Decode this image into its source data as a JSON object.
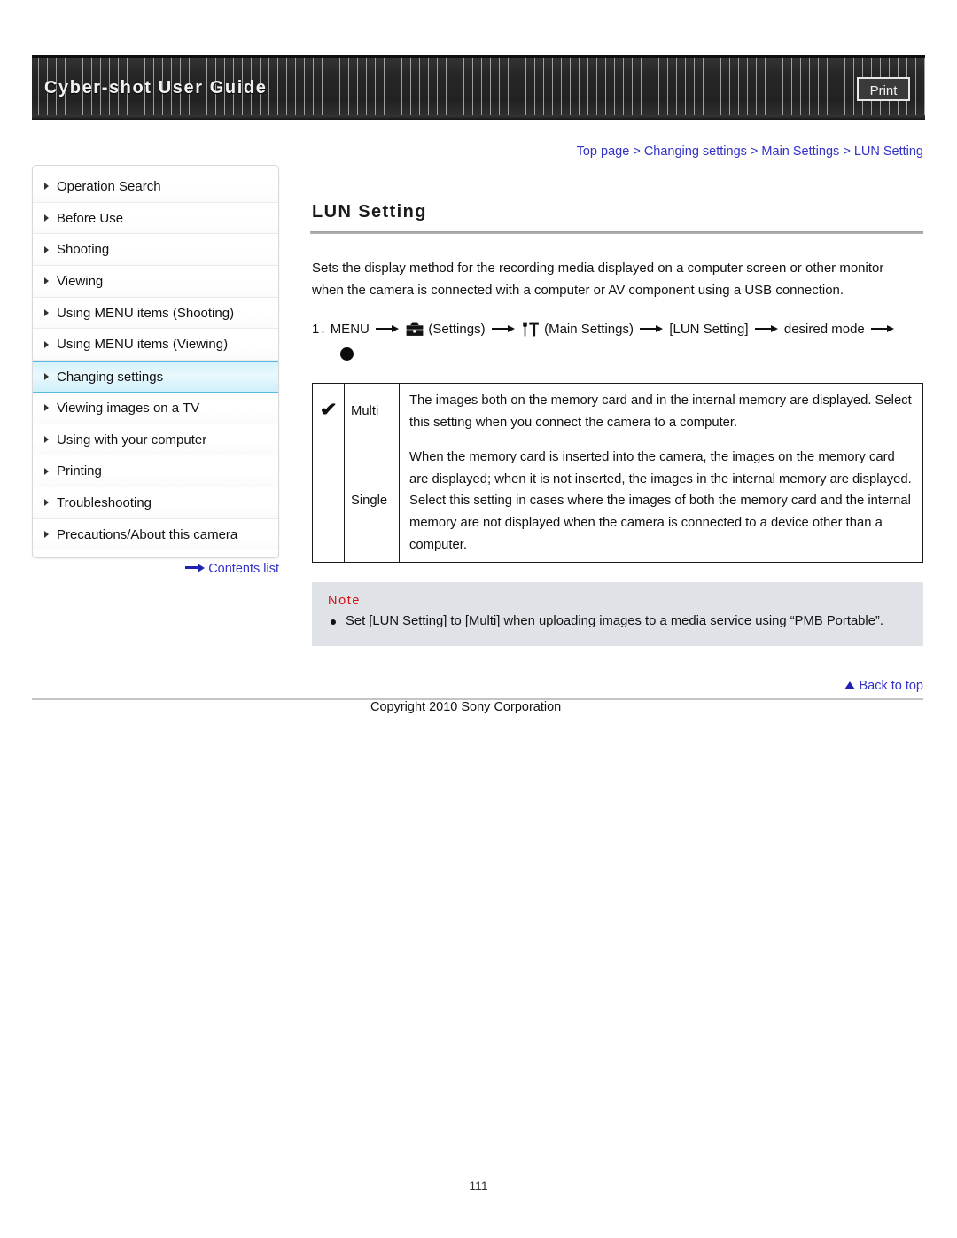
{
  "header": {
    "guide_title": "Cyber-shot User Guide",
    "print_label": "Print"
  },
  "breadcrumb": {
    "items": [
      "Top page",
      "Changing settings",
      "Main Settings",
      "LUN Setting"
    ],
    "separator": ">",
    "full_text": "Top page > Changing settings > Main Settings > LUN Setting",
    "link_color": "#3232c8"
  },
  "sidebar": {
    "items": [
      {
        "label": "Operation Search",
        "active": false
      },
      {
        "label": "Before Use",
        "active": false
      },
      {
        "label": "Shooting",
        "active": false
      },
      {
        "label": "Viewing",
        "active": false
      },
      {
        "label": "Using MENU items (Shooting)",
        "active": false
      },
      {
        "label": "Using MENU items (Viewing)",
        "active": false
      },
      {
        "label": "Changing settings",
        "active": true
      },
      {
        "label": "Viewing images on a TV",
        "active": false
      },
      {
        "label": "Using with your computer",
        "active": false
      },
      {
        "label": "Printing",
        "active": false
      },
      {
        "label": "Troubleshooting",
        "active": false
      },
      {
        "label": "Precautions/About this camera",
        "active": false
      }
    ],
    "contents_list_label": "Contents list",
    "active_highlight_color": "#d4f2fb",
    "active_border_color": "#57b9dd"
  },
  "main": {
    "heading": "LUN Setting",
    "intro": "Sets the display method for the recording media displayed on a computer screen or other monitor when the camera is connected with a computer or AV component using a USB connection.",
    "step": {
      "number": "1.",
      "part1": "MENU",
      "settings_label": "(Settings)",
      "main_settings_label": "(Main Settings)",
      "lun_label": "[LUN Setting]",
      "desired_mode_label": "desired mode",
      "settings_icon": "toolbox-icon",
      "main_settings_icon": "wrench-screwdriver-icon",
      "end_icon": "filled-circle-icon"
    },
    "table": {
      "rows": [
        {
          "checked": true,
          "check_glyph": "✔",
          "name": "Multi",
          "description": "The images both on the memory card and in the internal memory are displayed. Select this setting when you connect the camera to a computer."
        },
        {
          "checked": false,
          "check_glyph": "",
          "name": "Single",
          "description": "When the memory card is inserted into the camera, the images on the memory card are displayed; when it is not inserted, the images in the internal memory are displayed. Select this setting in cases where the images of both the memory card and the internal memory are not displayed when the camera is connected to a device other than a computer."
        }
      ]
    },
    "note": {
      "title": "Note",
      "title_color": "#d01010",
      "background_color": "#dfe3e8",
      "items": [
        "Set [LUN Setting] to [Multi] when uploading images to a media service using “PMB Portable”."
      ]
    }
  },
  "footer": {
    "back_to_top_label": "Back to top",
    "copyright": "Copyright 2010 Sony Corporation",
    "page_number": "111"
  }
}
